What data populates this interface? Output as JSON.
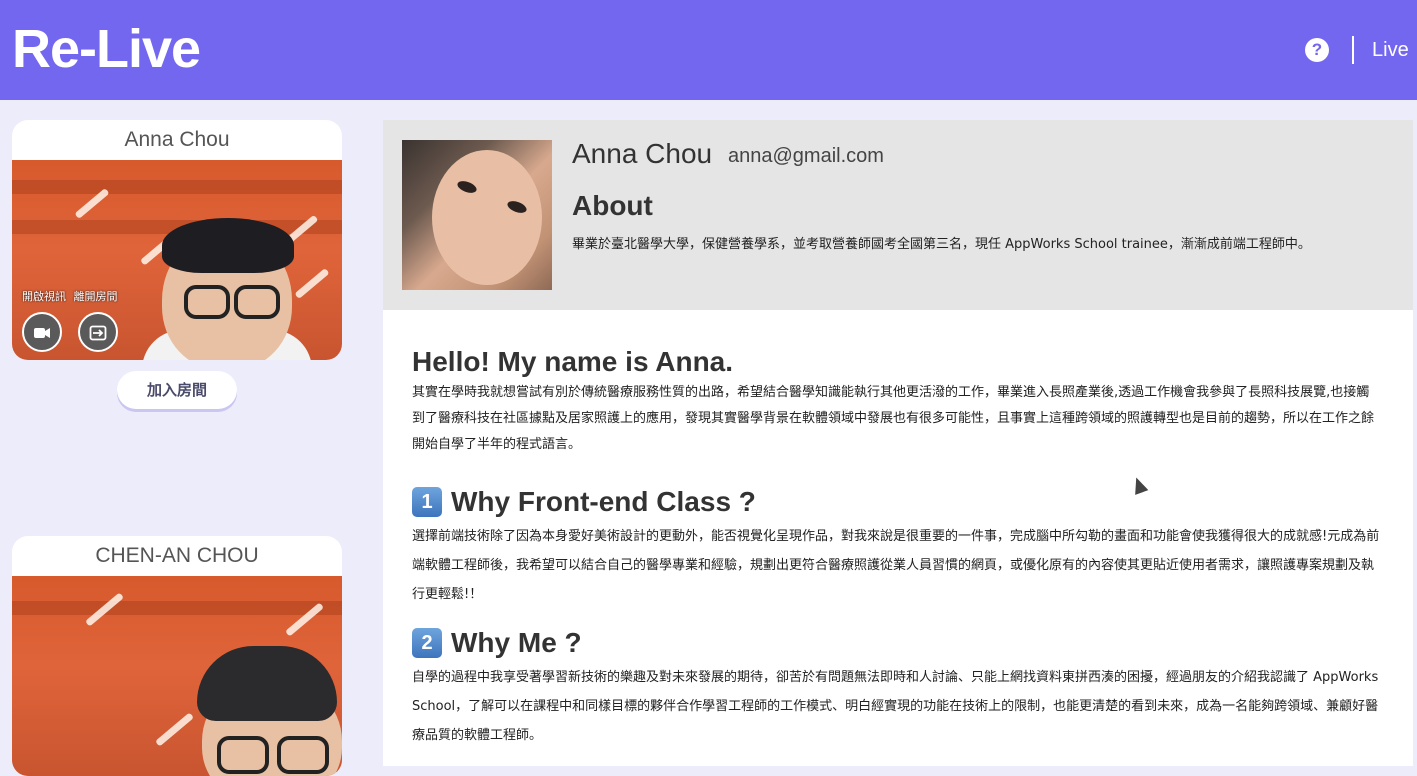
{
  "header": {
    "logo": "Re-Live",
    "help_icon": "?",
    "live_label": "Live"
  },
  "video_cards": [
    {
      "name": "Anna Chou",
      "controls": {
        "camera_label": "開啟視訊",
        "leave_label": "離開房間",
        "camera_icon": "video-camera-icon",
        "leave_icon": "exit-icon"
      }
    },
    {
      "name": "CHEN-AN CHOU"
    }
  ],
  "join_button": "加入房間",
  "profile": {
    "name": "Anna Chou",
    "email": "anna@gmail.com",
    "about_title": "About",
    "about_text": "畢業於臺北醫學大學，保健營養學系，並考取營養師國考全國第三名，現任 AppWorks School trainee，漸漸成前端工程師中。"
  },
  "content": {
    "intro_title": "Hello! My name is Anna.",
    "intro_text": "其實在學時我就想嘗試有別於傳統醫療服務性質的出路，希望結合醫學知識能執行其他更活潑的工作，畢業進入長照產業後,透過工作機會我參與了長照科技展覽,也接觸到了醫療科技在社區據點及居家照護上的應用，發現其實醫學背景在軟體領域中發展也有很多可能性，且事實上這種跨領域的照護轉型也是目前的趨勢，所以在工作之餘開始自學了半年的程式語言。",
    "section1_number": "1",
    "section1_title": "Why Front-end Class ?",
    "section1_text": "選擇前端技術除了因為本身愛好美術設計的更動外，能否視覺化呈現作品，對我來說是很重要的一件事，完成腦中所勾勒的畫面和功能會使我獲得很大的成就感!元成為前端軟體工程師後，我希望可以結合自己的醫學專業和經驗，規劃出更符合醫療照護從業人員習慣的網頁，或優化原有的內容使其更貼近使用者需求，讓照護專案規劃及執行更輕鬆!！",
    "section2_number": "2",
    "section2_title": "Why Me ?",
    "section2_text": "自學的過程中我享受著學習新技術的樂趣及對未來發展的期待，卻苦於有問題無法即時和人討論、只能上網找資料東拼西湊的困擾，經過朋友的介紹我認識了 AppWorks School，了解可以在課程中和同樣目標的夥伴合作學習工程師的工作模式、明白經實現的功能在技術上的限制，也能更清楚的看到未來，成為一名能夠跨領域、兼顧好醫療品質的軟體工程師。"
  },
  "colors": {
    "brand": "#7367ef",
    "page_bg": "#ececfb",
    "profile_bg": "#e5e5e5"
  }
}
